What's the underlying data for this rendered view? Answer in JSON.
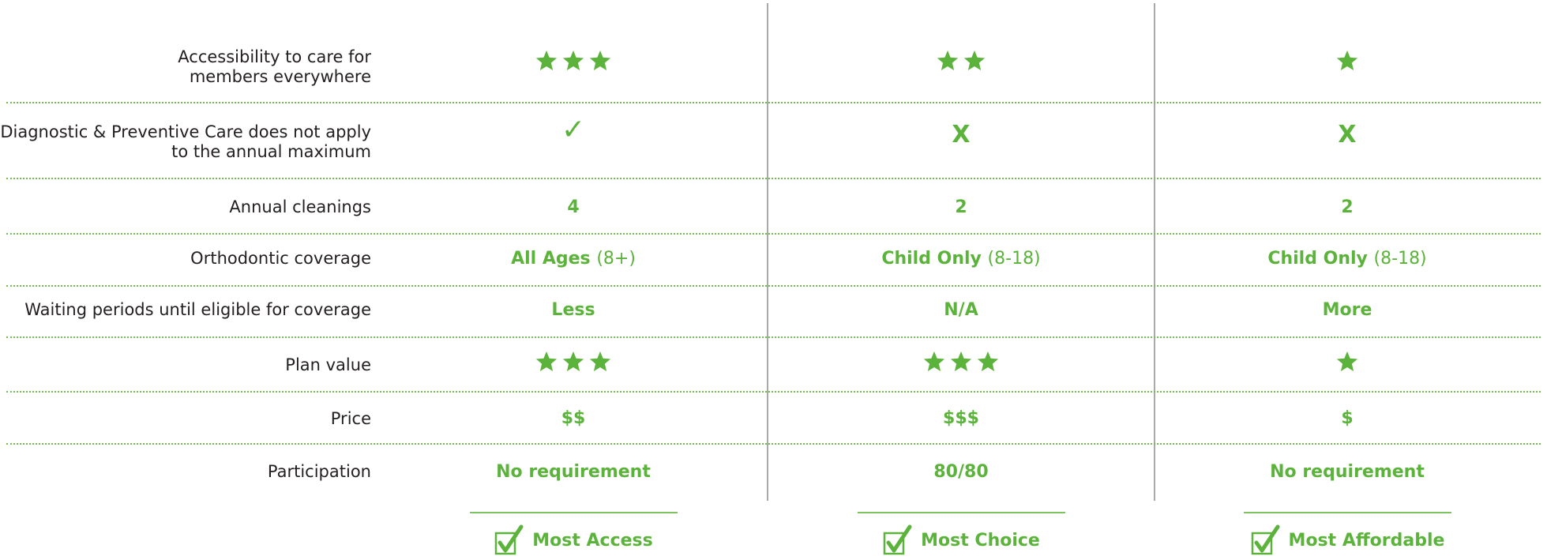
{
  "colors": {
    "accent": "#5bb33b",
    "text": "#231f20",
    "divider": "#a9a9a9"
  },
  "rows": [
    {
      "label_line1": "Accessibility to care for",
      "label_line2": "members everywhere",
      "plan1_stars": 3,
      "plan2_stars": 2,
      "plan3_stars": 1
    },
    {
      "label_line1": "Diagnostic & Preventive Care does not apply",
      "label_line2": "to the annual maximum",
      "plan1": "✓",
      "plan2": "X",
      "plan3": "X"
    },
    {
      "label": "Annual cleanings",
      "plan1": "4",
      "plan2": "2",
      "plan3": "2"
    },
    {
      "label": "Orthodontic coverage",
      "plan1": "All Ages",
      "plan1_sub": "(8+)",
      "plan2": "Child Only",
      "plan2_sub": "(8-18)",
      "plan3": "Child Only",
      "plan3_sub": "(8-18)"
    },
    {
      "label": "Waiting periods until eligible for coverage",
      "plan1": "Less",
      "plan2": "N/A",
      "plan3": "More"
    },
    {
      "label": "Plan value",
      "plan1_stars": 3,
      "plan2_stars": 3,
      "plan3_stars": 1
    },
    {
      "label": "Price",
      "plan1": "$$",
      "plan2": "$$$",
      "plan3": "$"
    },
    {
      "label": "Participation",
      "plan1": "No requirement",
      "plan2": "80/80",
      "plan3": "No requirement"
    }
  ],
  "footer": {
    "plan1": "Most Access",
    "plan2": "Most Choice",
    "plan3": "Most Affordable"
  }
}
